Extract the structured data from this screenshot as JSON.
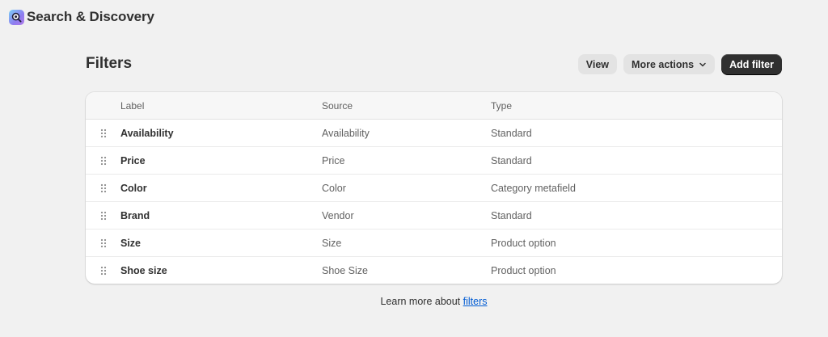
{
  "app": {
    "title": "Search & Discovery",
    "icon": "search-discovery-logo-icon"
  },
  "page": {
    "title": "Filters"
  },
  "actions": {
    "view_label": "View",
    "more_actions_label": "More actions",
    "add_filter_label": "Add filter"
  },
  "table": {
    "columns": {
      "label": "Label",
      "source": "Source",
      "type": "Type"
    },
    "rows": [
      {
        "label": "Availability",
        "source": "Availability",
        "type": "Standard"
      },
      {
        "label": "Price",
        "source": "Price",
        "type": "Standard"
      },
      {
        "label": "Color",
        "source": "Color",
        "type": "Category metafield"
      },
      {
        "label": "Brand",
        "source": "Vendor",
        "type": "Standard"
      },
      {
        "label": "Size",
        "source": "Size",
        "type": "Product option"
      },
      {
        "label": "Shoe size",
        "source": "Shoe Size",
        "type": "Product option"
      }
    ]
  },
  "footer": {
    "prefix": "Learn more about ",
    "link_text": "filters"
  },
  "colors": {
    "background": "#f1f1f1",
    "primary_button": "#303030",
    "link": "#005bd3"
  }
}
